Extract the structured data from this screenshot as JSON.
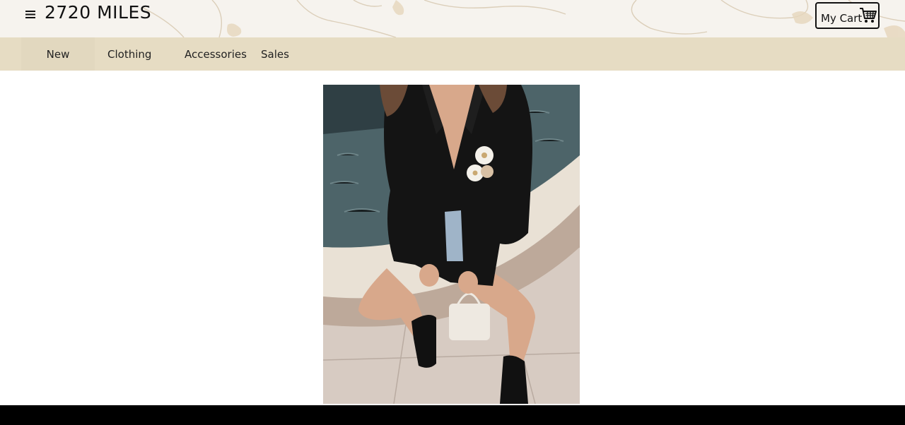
{
  "header": {
    "brand": "2720 MILES",
    "menu_icon": "hamburger-menu-icon",
    "cart": {
      "label": "My Cart",
      "icon": "shopping-cart-icon"
    }
  },
  "nav": {
    "items": [
      {
        "label": "New"
      },
      {
        "label": "Clothing"
      },
      {
        "label": "Accessories"
      },
      {
        "label": "Sales"
      }
    ]
  },
  "main": {
    "image_icon": "product-photo"
  },
  "colors": {
    "header_bg": "#f6f3ee",
    "nav_bg": "#e6dcc3",
    "footer_bg": "#000000",
    "text": "#111111"
  }
}
